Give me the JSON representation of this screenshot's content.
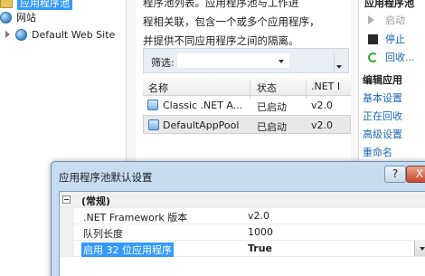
{
  "tree": {
    "selected_label": "应用程序池",
    "sites_label": "网站",
    "default_site_label": "Default Web Site"
  },
  "middle": {
    "desc_line1": "程序池列表。应用程序池与工作进",
    "desc_line2": "程相关联，包含一个或多个应用程序，",
    "desc_line3": "并提供不同应用程序之间的隔离。",
    "filter_label": "筛选:",
    "columns": [
      "名称",
      "状态",
      ".NET I"
    ],
    "rows": [
      {
        "name": "Classic .NET A...",
        "status": "已启动",
        "net": "v2.0"
      },
      {
        "name": "DefaultAppPool",
        "status": "已启动",
        "net": "v2.0"
      }
    ]
  },
  "actions": {
    "top_header": "应用程序池",
    "start": "启动",
    "stop": "停止",
    "recycle": "回收...",
    "edit_header": "编辑应用",
    "basic_settings": "基本设置",
    "recycling": "正在回收",
    "advanced": "高级设置",
    "rename": "重命名"
  },
  "dialog": {
    "title": "应用程序池默认设置",
    "help": "?",
    "close": "X",
    "category": "(常规)",
    "properties": [
      {
        "name": ".NET Framework 版本",
        "value": "v2.0"
      },
      {
        "name": "队列长度",
        "value": "1000"
      },
      {
        "name": "启用 32 位应用程序",
        "value": "True"
      }
    ]
  },
  "colors": {
    "selection": "#3399ff",
    "link": "#1c68b8",
    "dialog_chrome": "#c6dcf1"
  }
}
